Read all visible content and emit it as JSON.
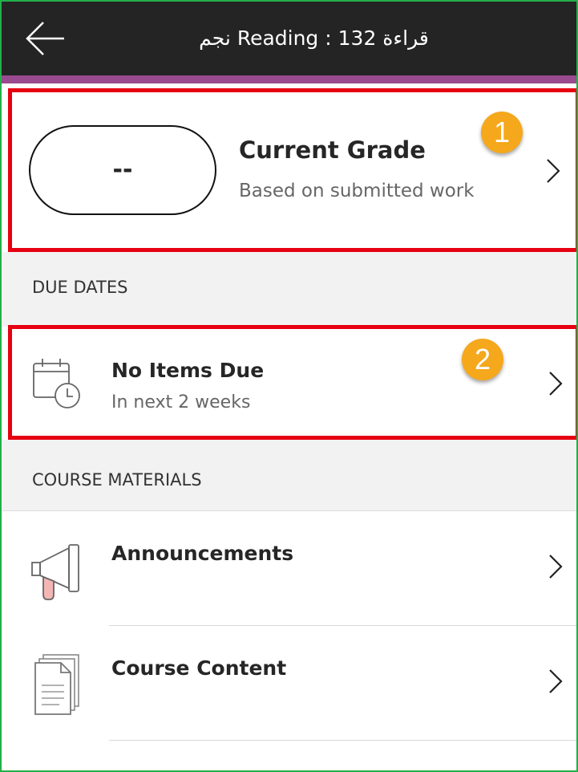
{
  "header": {
    "back_icon": "arrow-left-icon",
    "title": "قراءة 132 : Reading نجم",
    "background": "#242424",
    "accent_color": "#9a4a8f"
  },
  "grade": {
    "value": "--",
    "title": "Current Grade",
    "subtitle": "Based on submitted work",
    "badge": "1"
  },
  "due_dates": {
    "section_label": "DUE DATES",
    "icon": "calendar-clock-icon",
    "title": "No Items Due",
    "subtitle": "In next 2 weeks",
    "badge": "2"
  },
  "course_materials": {
    "section_label": "COURSE MATERIALS",
    "items": [
      {
        "label": "Announcements",
        "icon": "megaphone-icon"
      },
      {
        "label": "Course Content",
        "icon": "documents-icon"
      }
    ]
  },
  "colors": {
    "highlight_red": "#e60012",
    "badge_orange": "#f5a81c",
    "frame_green": "#22b04a"
  }
}
